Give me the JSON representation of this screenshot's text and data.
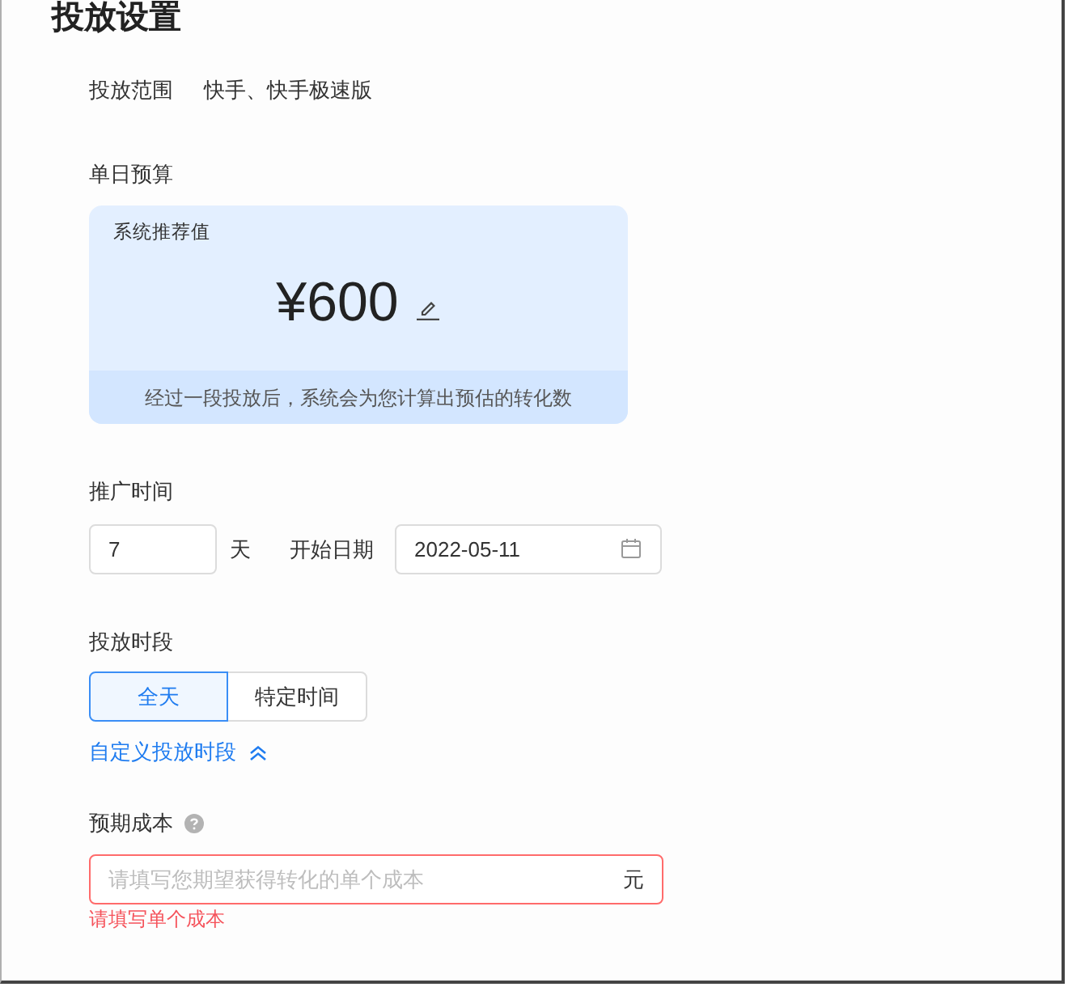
{
  "title": "投放设置",
  "scope": {
    "label": "投放范围",
    "value": "快手、快手极速版"
  },
  "budget": {
    "label": "单日预算",
    "card_title": "系统推荐值",
    "amount": "¥600",
    "note": "经过一段投放后，系统会为您计算出预估的转化数"
  },
  "schedule": {
    "label": "推广时间",
    "days": {
      "value": "7"
    },
    "days_unit": "天",
    "start_label": "开始日期",
    "start_date": {
      "value": "2022-05-11"
    }
  },
  "time_slot": {
    "label": "投放时段",
    "options": [
      {
        "label": "全天",
        "selected": true
      },
      {
        "label": "特定时间",
        "selected": false
      }
    ],
    "custom_link": {
      "label": "自定义投放时段",
      "expanded": true
    }
  },
  "cost": {
    "label": "预期成本",
    "field": {
      "placeholder": "请填写您期望获得转化的单个成本",
      "unit": "元",
      "invalid": true
    },
    "error": "请填写单个成本"
  }
}
